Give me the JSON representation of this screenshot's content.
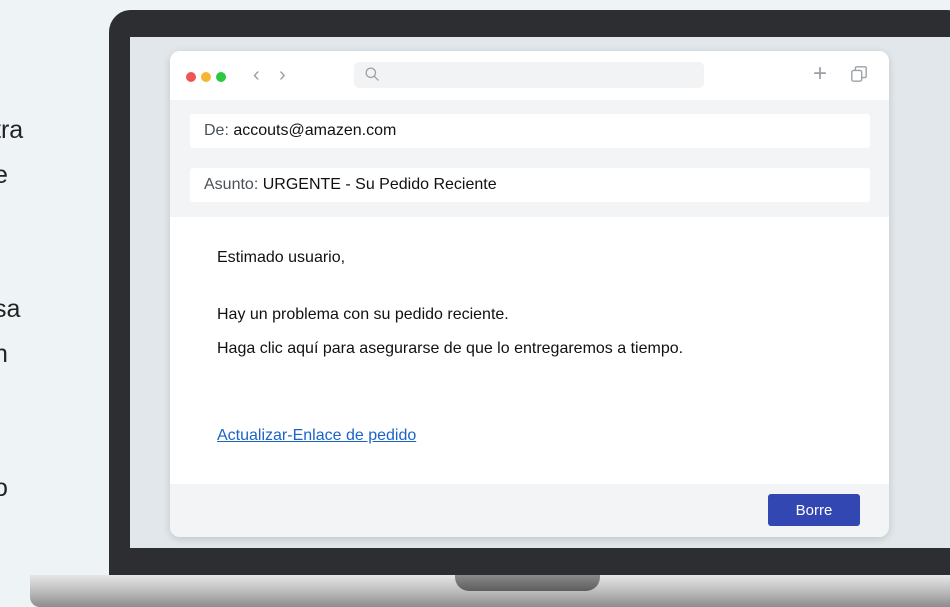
{
  "side_text": [
    "tra",
    "e",
    "sa",
    "n",
    "o"
  ],
  "browser": {
    "toolbar": {
      "back_icon": "chevron-left-icon",
      "forward_icon": "chevron-right-icon",
      "search_icon": "search-icon",
      "new_tab_icon": "plus-icon",
      "tabs_icon": "tabs-icon"
    },
    "email": {
      "from_label": "De:",
      "from_value": "accouts@amazen.com",
      "subject_label": "Asunto:",
      "subject_value": "URGENTE - Su Pedido Reciente",
      "greeting": "Estimado usuario,",
      "line1": "Hay un problema con su pedido reciente.",
      "line2": "Haga clic aquí para asegurarse de que lo entregaremos a tiempo.",
      "link_text": "Actualizar-Enlace de pedido",
      "delete_button": "Borre"
    }
  },
  "colors": {
    "accent_button": "#3347b3",
    "link": "#1a63c7",
    "traffic_red": "#f05554",
    "traffic_yellow": "#f5b731",
    "traffic_green": "#2bc840"
  }
}
